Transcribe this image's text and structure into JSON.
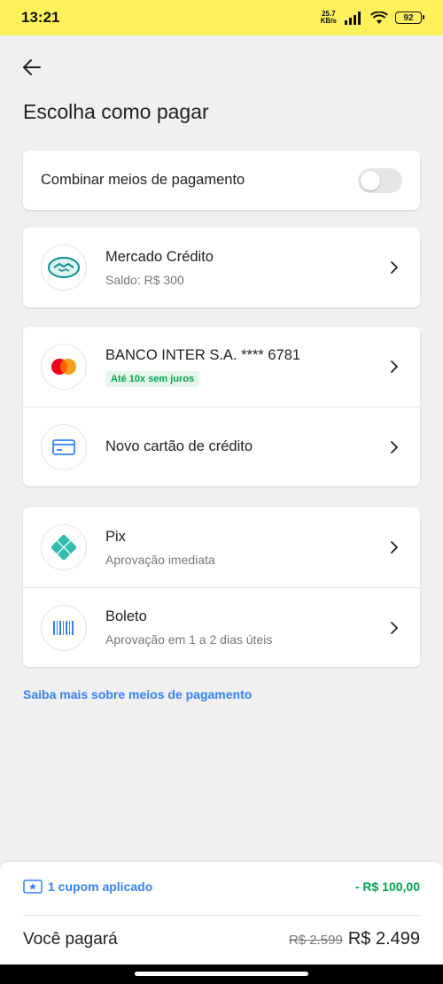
{
  "status_bar": {
    "time": "13:21",
    "net_speed_value": "25.7",
    "net_speed_unit": "KB/s",
    "battery": "92"
  },
  "page": {
    "title": "Escolha como pagar"
  },
  "combine": {
    "label": "Combinar meios de pagamento",
    "enabled": false
  },
  "methods": {
    "mercado_credito": {
      "title": "Mercado Crédito",
      "subtitle": "Saldo: R$ 300"
    },
    "banco_inter": {
      "title": "BANCO INTER S.A. **** 6781",
      "badge": "Até 10x sem juros"
    },
    "novo_cartao": {
      "title": "Novo cartão de crédito"
    },
    "pix": {
      "title": "Pix",
      "subtitle": "Aprovação imediata"
    },
    "boleto": {
      "title": "Boleto",
      "subtitle": "Aprovação em 1 a 2 dias úteis"
    }
  },
  "info_link": "Saiba mais sobre meios de pagamento",
  "footer": {
    "coupon_label": "1 cupom aplicado",
    "discount": "- R$ 100,00",
    "pay_label": "Você pagará",
    "old_price": "R$ 2.599",
    "new_price": "R$ 2.499"
  },
  "colors": {
    "status_bar": "#fff159",
    "accent_blue": "#3483fa",
    "green": "#00a650",
    "pix_teal": "#32bcad"
  }
}
